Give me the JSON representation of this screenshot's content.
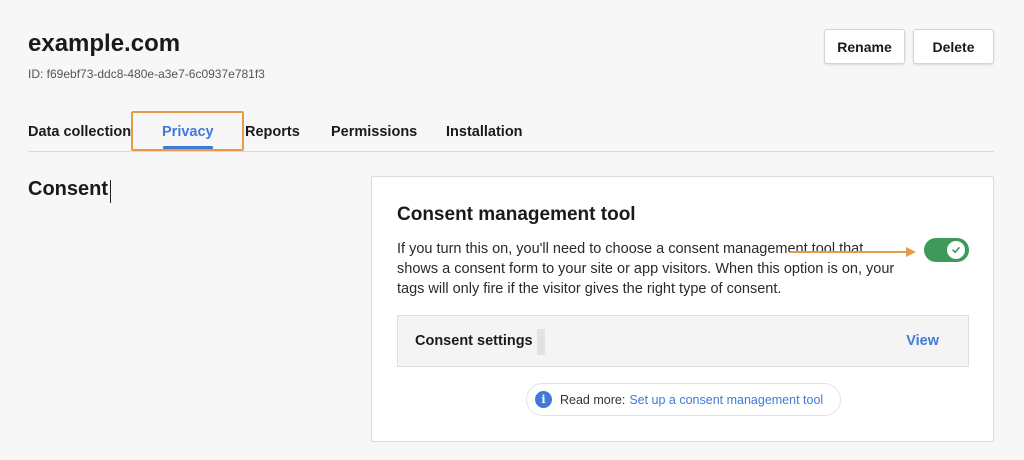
{
  "header": {
    "title": "example.com",
    "id_text": "ID: f69ebf73-ddc8-480e-a3e7-6c0937e781f3",
    "rename_label": "Rename",
    "delete_label": "Delete"
  },
  "tabs": [
    {
      "label": "Data collection",
      "active": false
    },
    {
      "label": "Privacy",
      "active": true
    },
    {
      "label": "Reports",
      "active": false
    },
    {
      "label": "Permissions",
      "active": false
    },
    {
      "label": "Installation",
      "active": false
    }
  ],
  "section": {
    "title": "Consent"
  },
  "card": {
    "title": "Consent management tool",
    "description": "If you turn this on, you'll need to choose a consent management tool that shows a consent form to your site or app visitors. When this option is on, your tags will only fire if the visitor gives the right type of consent.",
    "toggle": {
      "on": true,
      "icon": "check-icon"
    },
    "settings": {
      "label": "Consent settings",
      "action": "View"
    },
    "read_more": {
      "icon": "info-icon",
      "prefix": "Read more:",
      "link": "Set up a consent management tool"
    }
  },
  "colors": {
    "accent": "#3f7ad8",
    "toggle_on": "#3d9a5b",
    "annotation": "#e59b47"
  }
}
